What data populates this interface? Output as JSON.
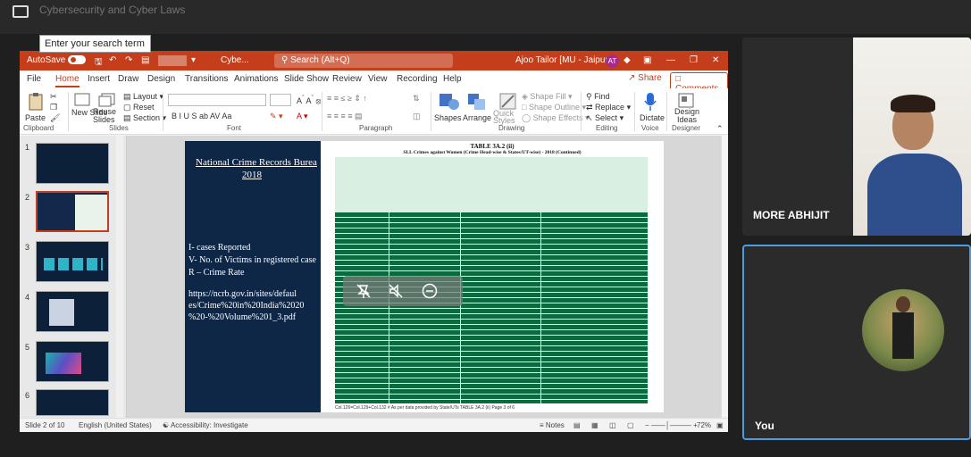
{
  "window": {
    "faded_title": "Cybersecurity and Cyber Laws"
  },
  "tooltip": {
    "text": "Enter your search term"
  },
  "titlebar": {
    "autosave_label": "AutoSave",
    "autosave_state": "On",
    "file_name": "Cybe...",
    "search_placeholder": "Search (Alt+Q)",
    "user_name": "Ajoo Tailor [MU - Jaipur]",
    "user_initials": "AT"
  },
  "menu": {
    "tabs": [
      "File",
      "Home",
      "Insert",
      "Draw",
      "Design",
      "Transitions",
      "Animations",
      "Slide Show",
      "Review",
      "View",
      "Recording",
      "Help"
    ],
    "share_label": "Share",
    "comments_label": "Comments"
  },
  "ribbon": {
    "paste": "Paste",
    "new_slide": "New Slide",
    "reuse_slides": "Reuse Slides",
    "layout": "Layout",
    "reset": "Reset",
    "section": "Section",
    "font_sample": "B  I  U  S  ab  AV  Aa",
    "shapes": "Shapes",
    "arrange": "Arrange",
    "quick_styles": "Quick Styles",
    "shape_fill": "Shape Fill",
    "shape_outline": "Shape Outline",
    "shape_effects": "Shape Effects",
    "find": "Find",
    "replace": "Replace",
    "select": "Select",
    "dictate": "Dictate",
    "design_ideas": "Design Ideas",
    "groups": [
      "Clipboard",
      "Slides",
      "Font",
      "Paragraph",
      "Drawing",
      "Editing",
      "Voice",
      "Designer"
    ]
  },
  "thumbnails": [
    "1",
    "2",
    "3",
    "4",
    "5",
    "6"
  ],
  "slide": {
    "title_line1": "National Crime Records Burea",
    "title_line2": "2018",
    "legend_line1": "I- cases Reported",
    "legend_line2": "V- No. of Victims in registered case",
    "legend_line3": "R – Crime Rate",
    "url_line1": "https://ncrb.gov.in/sites/defaul",
    "url_line2": "es/Crime%20in%20India%2020",
    "url_line3": "%20-%20Volume%201_3.pdf",
    "table_title_1": "TABLE 3A.2 (ii)",
    "table_title_2": "SLL Crimes against Women (Crime Head-wise & States/UT-wise) - 2018 (Continued)",
    "table_footer": "Col.126=Col.129+Col.132   # As per data provided by State/UTs   TABLE 3A.2 (ii) Page 3 of 6"
  },
  "status": {
    "slide_of": "Slide 2 of 10",
    "language": "English (United States)",
    "accessibility": "Accessibility: Investigate",
    "notes": "Notes",
    "zoom": "72%"
  },
  "participants": [
    {
      "name": "MORE ABHIJIT"
    },
    {
      "name": "You"
    }
  ]
}
